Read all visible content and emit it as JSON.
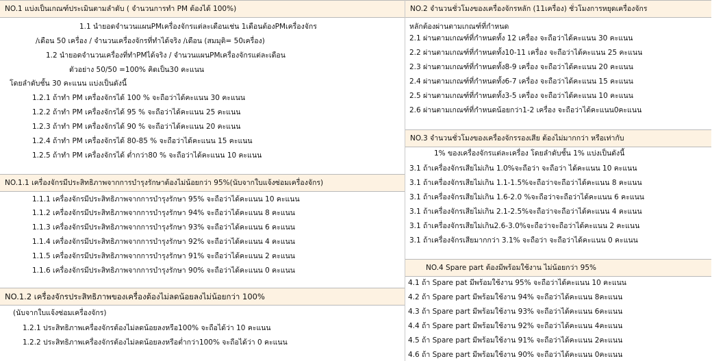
{
  "left": {
    "s1": {
      "header": "NO.1 แบ่งเป็นเกณฑ์ประเมินตามลำดับ ( จำนวนการทำ PM ต้องได้ 100%)",
      "lines": [
        "1.1 นำยอดจำนวนแผนPMเครื่องจักรแต่ละเดือนเช่น 1เดือนต้องPMเครื่องจักร",
        "/เดือน  50 เครื่อง /  จำนวนเครื่องจักรที่ทำได้จริง /เดือน  (สมมุติ= 50เครื่อง)",
        "1.2 นำยอดจำนวนเครื่องที่ทำPMได้จริง / จำนวนแผนPMเครื่องจักรแต่ละเดือน",
        "ตัวอย่าง  50/50 =100% คิดเป็น30 คะแนน",
        "โดยลำดับชั้น 30 คะแนน แบ่งเป็นดังนี้",
        "1.2.1 ถ้าทำ PM เครื่องจักรได้ 100 % จะถือว่าได้คะแนน 30 คะแนน",
        "1.2.2 ถ้าทำ PM เครื่องจักรได้ 95 % จะถือว่าได้คะแนน 25 คะแนน",
        "1.2.3 ถ้าทำ PM เครื่องจักรได้ 90 % จะถือว่าได้คะแนน 20 คะแนน",
        "1.2.4 ถ้าทำ PM เครื่องจักรได้ 80-85 % จะถือว่าได้คะแนน 15 คะแนน",
        "1.2.5 ถ้าทำ PM เครื่องจักรได้ ต่ำกว่า80 % จะถือว่าได้คะแนน 10 คะแนน"
      ]
    },
    "s2": {
      "header": "NO.1.1 เครื่องจักรมีประสิทธิภาพจากการบำรุงรักษาต้องไม่น้อยกว่า 95%(นับจากใบแจ้งซ่อมเครื่องจักร)",
      "lines": [
        "1.1.1 เครื่องจักรมีประสิทธิภาพจากการบำรุงรักษา 95% จะถือว่าได้คะแนน  10 คะแนน",
        "1.1.2 เครื่องจักรมีประสิทธิภาพจากการบำรุงรักษา 94% จะถือว่าได้คะแนน     8 คะแนน",
        "1.1.3 เครื่องจักรมีประสิทธิภาพจากการบำรุงรักษา 93% จะถือว่าได้คะแนน     6 คะแนน",
        "1.1.4 เครื่องจักรมีประสิทธิภาพจากการบำรุงรักษา 92% จะถือว่าได้คะแนน     4 คะแนน",
        "1.1.5 เครื่องจักรมีประสิทธิภาพจากการบำรุงรักษา 91% จะถือว่าได้คะแนน     2 คะแนน",
        "1.1.6 เครื่องจักรมีประสิทธิภาพจากการบำรุงรักษา 90% จะถือว่าได้คะแนน     0 คะแนน"
      ]
    },
    "s3": {
      "header": "NO.1.2 เครื่องจักรประสิทธิภาพของเครื่องต้องไม่ลดน้อยลงไม่น้อยกว่า 100%",
      "lines": [
        "(นับจากใบแจ้งซ่อมเครื่องจักร)",
        "1.2.1 ประสิทธิภาพเครื่องจักรต้องไม่ลดน้อยลงหรือ100% จะถือได้ว่า 10 คะแนน",
        "1.2.2 ประสิทธิภาพเครื่องจักรต้องไม่ลดน้อยลงหรือต่ำกว่า100% จะถือได้ว่า 0 คะแนน"
      ]
    }
  },
  "right": {
    "s1": {
      "header": "NO.2 จำนวนชั่วโมงของเครื่องจักรหลัก (11เครื่อง) ชั่วโมงการหยุดเครื่องจักร",
      "lines": [
        "หลักต้องผ่านตามเกณฑ์ที่กำหนด",
        "2.1 ผ่านตามเกณฑ์ที่กำหนดทั้ง  12  เครื่อง จะถือว่าได้คะแนน    30 คะแนน",
        "2.2 ผ่านตามเกณฑ์ที่กำหนดทั้ง10-11 เครื่อง จะถือว่าได้คะแนน 25 คะแนน",
        "2.3 ผ่านตามเกณฑ์ที่กำหนดทั้ง8-9  เครื่อง จะถือว่าได้คะแนน     20  คะแนน",
        "2.4 ผ่านตามเกณฑ์ที่กำหนดทั้ง6-7  เครื่อง จะถือว่าได้คะแนน     15  คะแนน",
        "2.5 ผ่านตามเกณฑ์ที่กำหนดทั้ง3-5  เครื่อง จะถือว่าได้คะแนน     10  คะแนน",
        "2.6 ผ่านตามเกณฑ์ที่กำหนดน้อยกว่า1-2  เครื่อง จะถือว่าได้คะแนน0คะแนน"
      ]
    },
    "s2": {
      "header": "NO.3 จำนวนชั่วโมงของเครื่องจักรรองเสีย ต้องไม่มากกว่า หรือเท่ากับ",
      "lines": [
        "1% ของเครื่องจักรแต่ละเครื่อง   โดยลำดับชั้น 1%  แบ่งเป็นดังนี้",
        "3.1 ถ้าเครื่องจักรเสียไม่เกิน 1.0%จะถือว่า  จะถือว่า      ได้คะแนน 10 คะแนน",
        "3.1 ถ้าเครื่องจักรเสียไม่เกิน 1.1-1.5%จะถือว่าจะถือว่าได้คะแนน  8 คะแนน",
        "3.1 ถ้าเครื่องจักรเสียไม่เกิน 1.6-2.0 %จะถือว่าจะถือว่าได้คะแนน 6 คะแนน",
        "3.1 ถ้าเครื่องจักรเสียไม่เกิน 2.1-2.5%จะถือว่าจะถือว่าได้คะแนน  4 คะแนน",
        "3.1 ถ้าเครื่องจักรเสียไม่เกิน2.6-3.0%จะถือว่าจะถือว่าได้คะแนน   2 คะแนน",
        "3.1 ถ้าเครื่องจักรเสียมากกว่า 3.1%  จะถือว่า จะถือว่าได้คะแนน  0  คะแนน"
      ]
    },
    "s3": {
      "header": "NO.4 Spare part ต้องมีพร้อมใช้งาน ไม่น้อยกว่า 95%",
      "lines": [
        "4.1 ถ้า Spare pat มีพร้อมใช้งาน 95%   จะถือว่าได้คะแนน 10 คะแนน",
        "4.2 ถ้า Spare part มีพร้อมใช้งาน 94% จะถือว่าได้คะแนน 8คะแนน",
        "4.3 ถ้า Spare part มีพร้อมใช้งาน 93% จะถือว่าได้คะแนน 6คะแนน",
        "4.4 ถ้า Spare part มีพร้อมใช้งาน 92% จะถือว่าได้คะแนน 4คะแนน",
        "4.5 ถ้า Spare part มีพร้อมใช้งาน 91% จะถือว่าได้คะแนน 2คะแนน",
        "4.6 ถ้า Spare part มีพร้อมใช้งาน 90% จะถือว่าได้คะแนน 0คะแนน"
      ]
    }
  }
}
